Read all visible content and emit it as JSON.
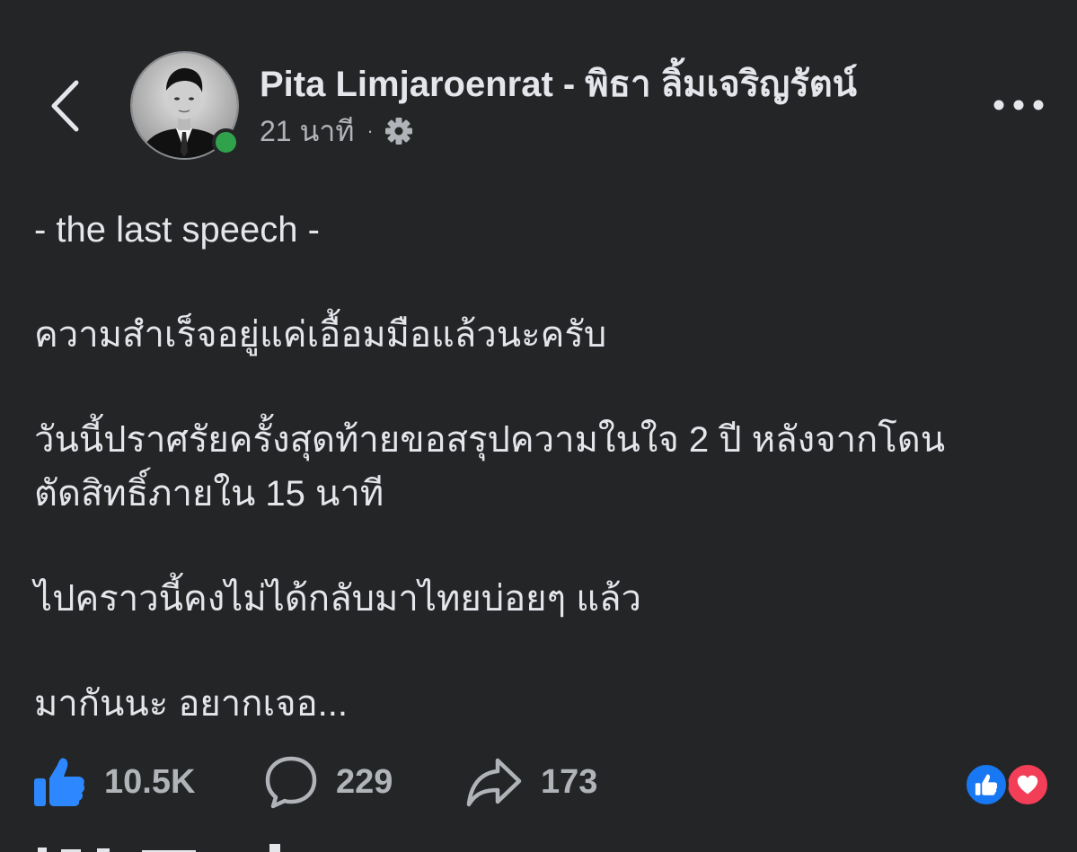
{
  "colors": {
    "background": "#242526",
    "primary_text": "#e4e6eb",
    "secondary_text": "#b0b3b8",
    "like_blue": "#1877f2",
    "love_red": "#f33e58",
    "online_green": "#31a24c"
  },
  "header": {
    "back_icon": "chevron-left-icon",
    "author_name": "Pita Limjaroenrat - พิธา ลิ้มเจริญรัตน์",
    "timestamp": "21 นาที",
    "separator": "·",
    "audience_icon": "gear-icon",
    "more_icon": "more-horizontal-icon",
    "online": true
  },
  "post": {
    "paragraphs": [
      [
        "- the last speech -"
      ],
      [
        "ความสำเร็จอยู่แค่เอื้อมมือแล้วนะครับ"
      ],
      [
        "วันนี้ปราศรัยครั้งสุดท้ายขอสรุปความในใจ 2 ปี หลังจากโดน",
        "ตัดสิทธิ์ภายใน 15 นาที"
      ],
      [
        "ไปคราวนี้คงไม่ได้กลับมาไทยบ่อยๆ แล้ว"
      ],
      [
        "มากันนะ อยากเจอ..."
      ]
    ]
  },
  "actions": {
    "like_count": "10.5K",
    "comment_count": "229",
    "share_count": "173",
    "like_icon": "thumbs-up-icon",
    "comment_icon": "comment-bubble-icon",
    "share_icon": "share-arrow-icon"
  },
  "reactions": [
    "like",
    "love"
  ]
}
